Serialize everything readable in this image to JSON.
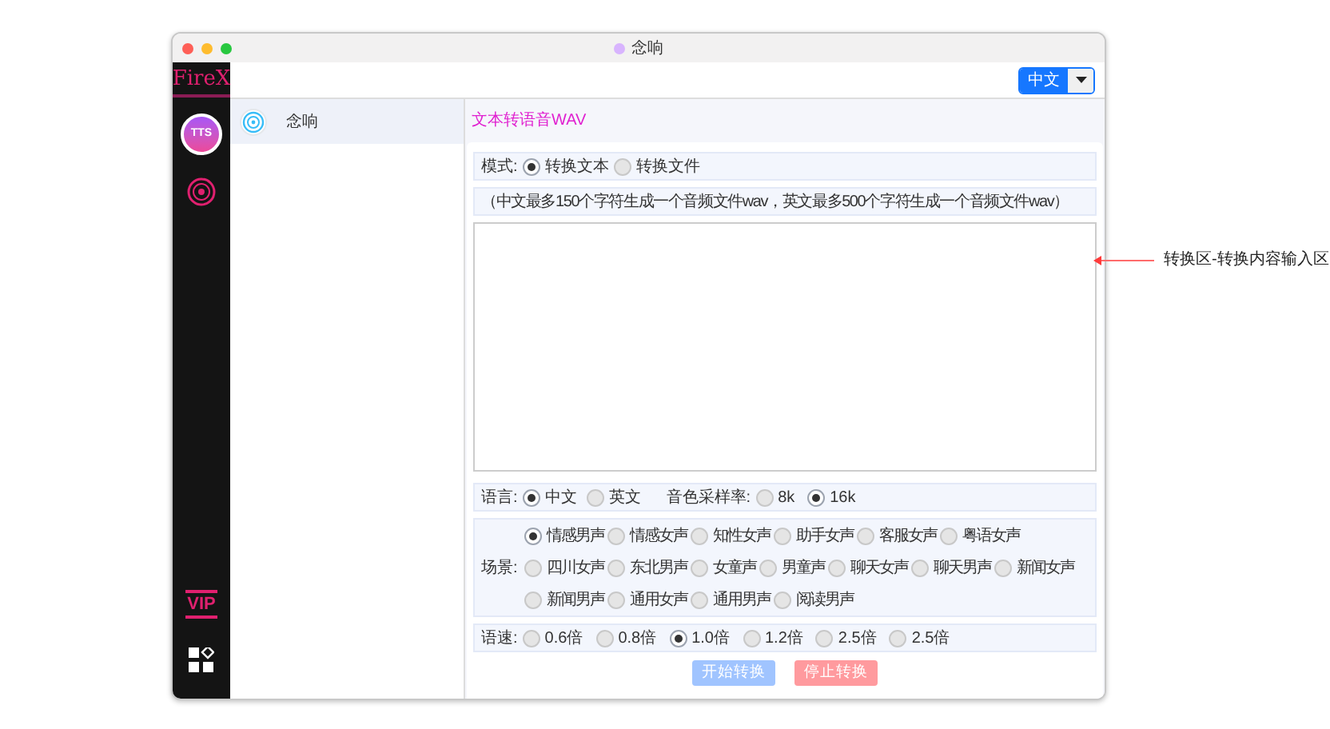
{
  "window": {
    "title": "念响"
  },
  "top_bar": {
    "language_button": "中文"
  },
  "sidebar": {
    "logo": "FireX",
    "tts_badge": "TTS",
    "vip": "VIP"
  },
  "app_list": [
    {
      "name": "念响",
      "selected": true
    }
  ],
  "header": "文本转语音WAV",
  "mode": {
    "label": "模式:",
    "options": [
      {
        "label": "转换文本",
        "selected": true
      },
      {
        "label": "转换文件",
        "selected": false
      }
    ]
  },
  "note": "（中文最多150个字符生成一个音频文件wav，英文最多500个字符生成一个音频文件wav）",
  "language": {
    "label": "语言:",
    "options": [
      {
        "label": "中文",
        "selected": true
      },
      {
        "label": "英文",
        "selected": false
      }
    ]
  },
  "sample_rate": {
    "label": "音色采样率:",
    "options": [
      {
        "label": "8k",
        "selected": false
      },
      {
        "label": "16k",
        "selected": true
      }
    ]
  },
  "scene": {
    "label": "场景:",
    "options": [
      {
        "label": "情感男声",
        "selected": true
      },
      {
        "label": "情感女声",
        "selected": false
      },
      {
        "label": "知性女声",
        "selected": false
      },
      {
        "label": "助手女声",
        "selected": false
      },
      {
        "label": "客服女声",
        "selected": false
      },
      {
        "label": "粤语女声",
        "selected": false
      },
      {
        "label": "四川女声",
        "selected": false
      },
      {
        "label": "东北男声",
        "selected": false
      },
      {
        "label": "女童声",
        "selected": false
      },
      {
        "label": "男童声",
        "selected": false
      },
      {
        "label": "聊天女声",
        "selected": false
      },
      {
        "label": "聊天男声",
        "selected": false
      },
      {
        "label": "新闻女声",
        "selected": false
      },
      {
        "label": "新闻男声",
        "selected": false
      },
      {
        "label": "通用女声",
        "selected": false
      },
      {
        "label": "通用男声",
        "selected": false
      },
      {
        "label": "阅读男声",
        "selected": false
      }
    ]
  },
  "speed": {
    "label": "语速:",
    "options": [
      {
        "label": "0.6倍",
        "selected": false
      },
      {
        "label": "0.8倍",
        "selected": false
      },
      {
        "label": "1.0倍",
        "selected": true
      },
      {
        "label": "1.2倍",
        "selected": false
      },
      {
        "label": "2.5倍",
        "selected": false
      },
      {
        "label": "2.5倍",
        "selected": false
      }
    ]
  },
  "buttons": [
    {
      "label": "开始转换",
      "kind": "start"
    },
    {
      "label": "停止转换",
      "kind": "stop"
    }
  ],
  "annotation": "转换区-转换内容输入区"
}
